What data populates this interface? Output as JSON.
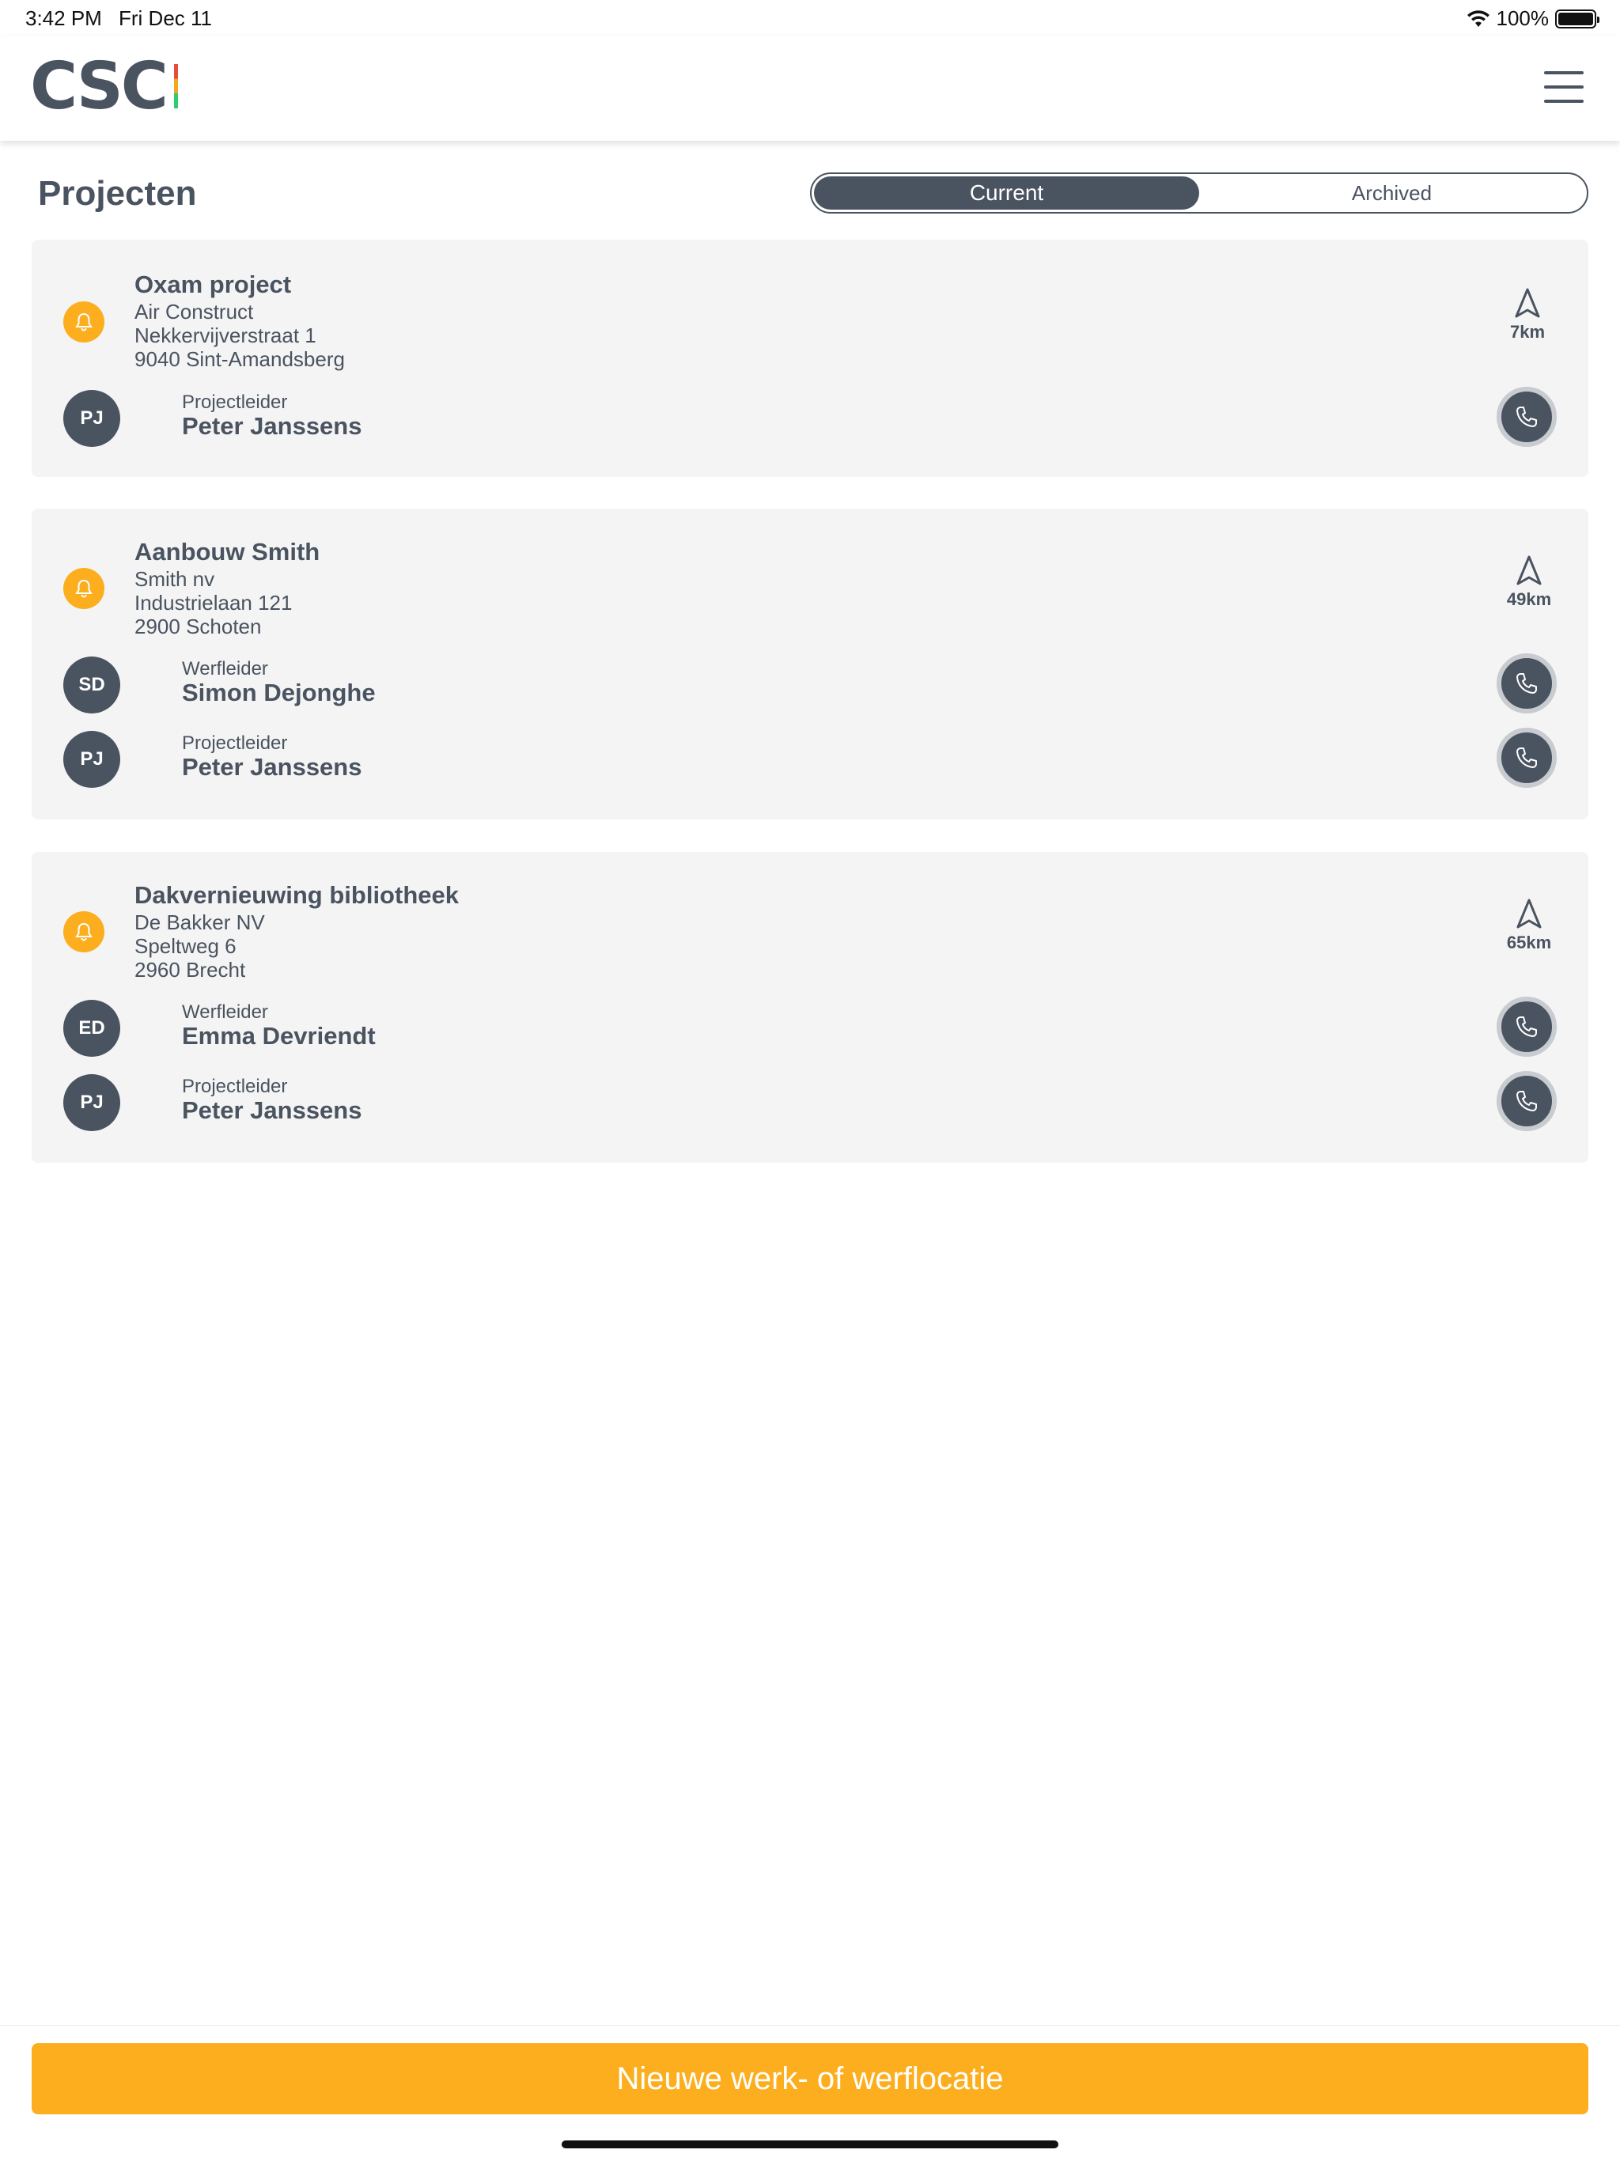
{
  "status_bar": {
    "time": "3:42 PM",
    "date": "Fri Dec 11",
    "battery": "100%"
  },
  "header": {
    "logo": "CSC"
  },
  "page": {
    "title": "Projecten"
  },
  "segment": {
    "current": "Current",
    "archived": "Archived",
    "selected": "Current"
  },
  "projects": [
    {
      "name": "Oxam project",
      "company": "Air Construct",
      "street": "Nekkervijverstraat 1",
      "city": "9040 Sint-Amandsberg",
      "distance": "7km",
      "people": [
        {
          "initials": "PJ",
          "role": "Projectleider",
          "name": "Peter Janssens"
        }
      ]
    },
    {
      "name": "Aanbouw Smith",
      "company": "Smith nv",
      "street": "Industrielaan 121",
      "city": "2900 Schoten",
      "distance": "49km",
      "people": [
        {
          "initials": "SD",
          "role": "Werfleider",
          "name": "Simon Dejonghe"
        },
        {
          "initials": "PJ",
          "role": "Projectleider",
          "name": "Peter Janssens"
        }
      ]
    },
    {
      "name": "Dakvernieuwing bibliotheek",
      "company": "De Bakker NV",
      "street": "Speltweg 6",
      "city": "2960 Brecht",
      "distance": "65km",
      "people": [
        {
          "initials": "ED",
          "role": "Werfleider",
          "name": "Emma Devriendt"
        },
        {
          "initials": "PJ",
          "role": "Projectleider",
          "name": "Peter Janssens"
        }
      ]
    }
  ],
  "cta": {
    "label": "Nieuwe werk- of werflocatie"
  },
  "colors": {
    "accent": "#fcae1e",
    "primary": "#4a5360",
    "card_bg": "#f4f4f4"
  }
}
